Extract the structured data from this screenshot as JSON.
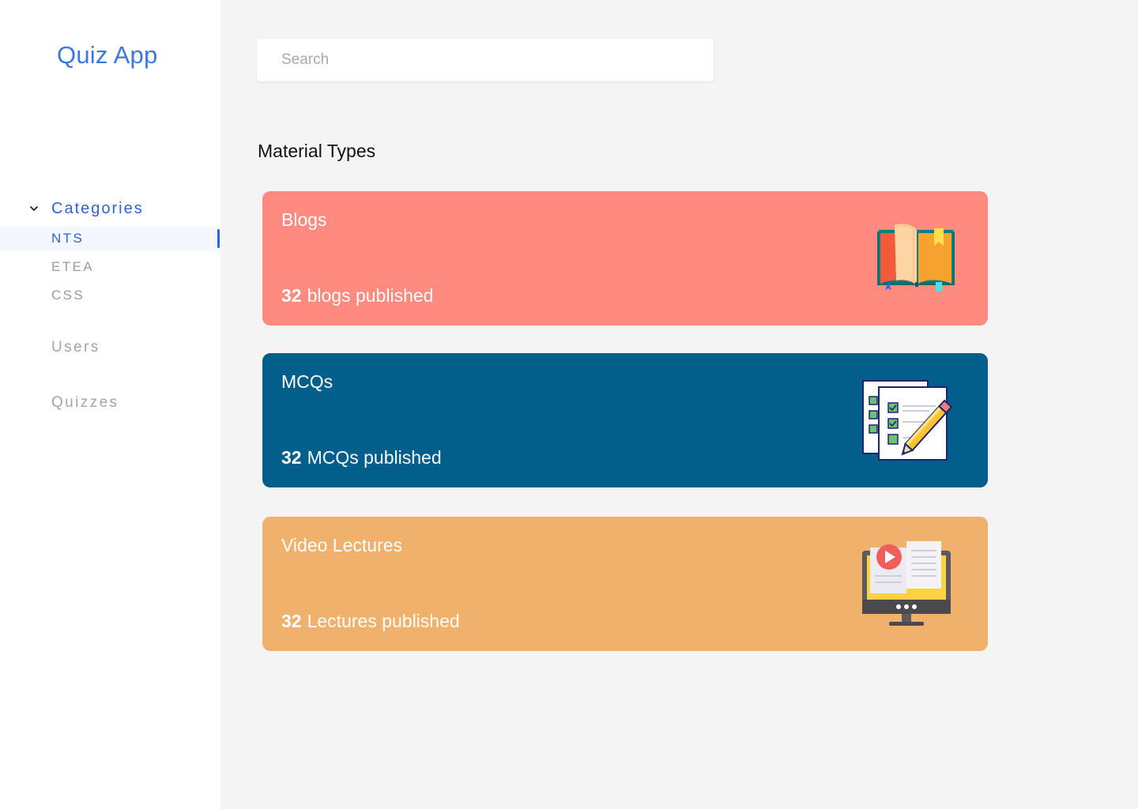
{
  "app": {
    "title": "Quiz App"
  },
  "sidebar": {
    "categories_label": "Categories",
    "categories": [
      {
        "label": "NTS",
        "active": true
      },
      {
        "label": "ETEA",
        "active": false
      },
      {
        "label": "CSS",
        "active": false
      }
    ],
    "users_label": "Users",
    "quizzes_label": "Quizzes"
  },
  "search": {
    "placeholder": "Search",
    "value": ""
  },
  "main": {
    "section_title": "Material Types",
    "cards": [
      {
        "title": "Blogs",
        "count": "32",
        "count_label": "blogs published",
        "color": "#ff8a7f",
        "icon": "open-book-icon"
      },
      {
        "title": "MCQs",
        "count": "32",
        "count_label": "MCQs published",
        "color": "#025e8b",
        "icon": "checklist-pencil-icon"
      },
      {
        "title": "Video Lectures",
        "count": "32",
        "count_label": "Lectures published",
        "color": "#f0b16c",
        "icon": "video-lecture-monitor-icon"
      }
    ]
  }
}
